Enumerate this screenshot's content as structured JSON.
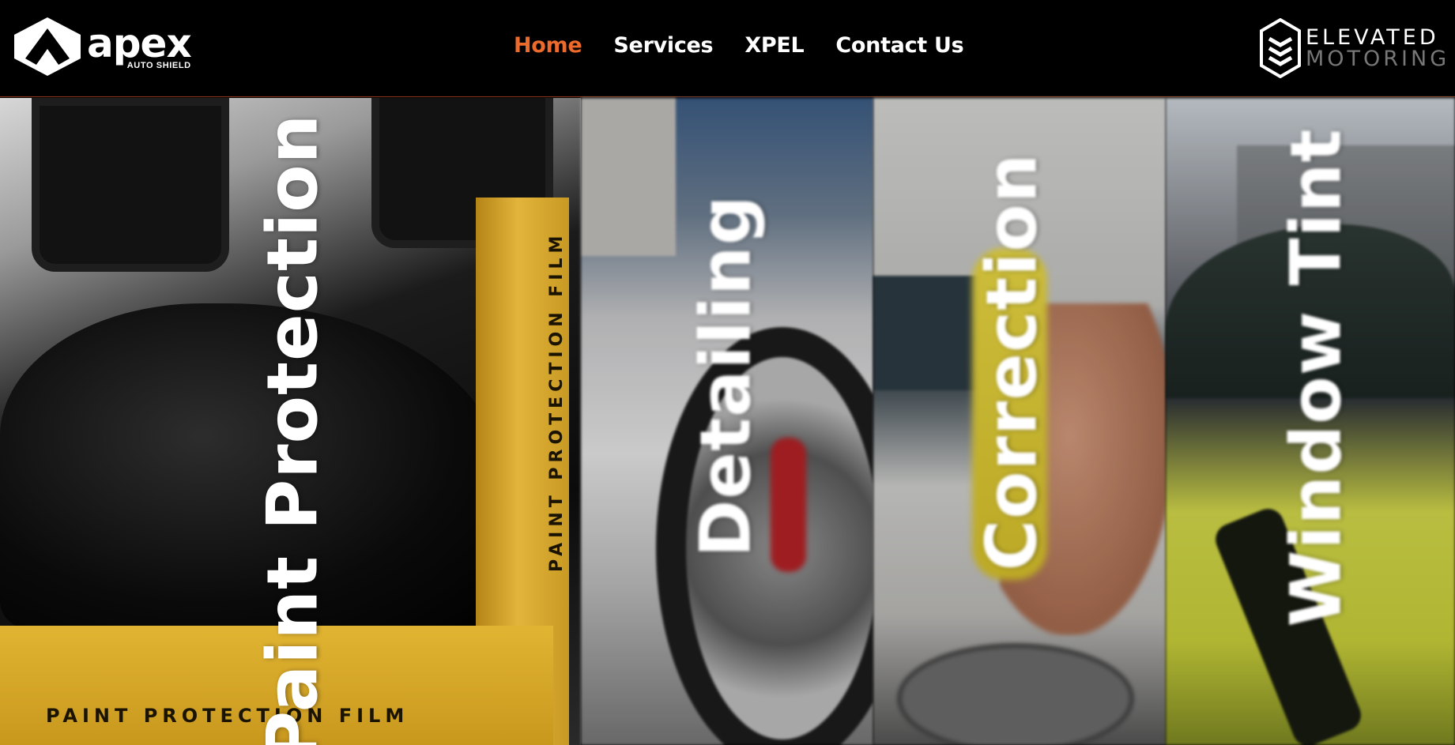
{
  "header": {
    "left_logo": {
      "name": "apex",
      "subtitle": "AUTO SHIELD",
      "icon": "apex-shield-icon"
    },
    "nav": [
      {
        "label": "Home",
        "active": true
      },
      {
        "label": "Services",
        "active": false
      },
      {
        "label": "XPEL",
        "active": false
      },
      {
        "label": "Contact Us",
        "active": false
      }
    ],
    "right_logo": {
      "line1": "ELEVATED",
      "line2": "MOTORING",
      "icon": "elevated-motoring-hexagon-icon"
    }
  },
  "panels": [
    {
      "label": "Paint Protection",
      "image": "black-supercar-with-paint-protection-film-box"
    },
    {
      "label": "Detailing",
      "image": "foamed-white-car-wheel"
    },
    {
      "label": "Correction",
      "image": "hand-polishing-white-car"
    },
    {
      "label": "Window Tint",
      "image": "yellow-car-near-building"
    }
  ],
  "photo_text": {
    "film_box": "PAINT PROTECTION FILM",
    "film_tube": "PAINT PROTECTION FILM"
  },
  "colors": {
    "background": "#000000",
    "nav_active": "#ec6a2c",
    "nav_text": "#ffffff",
    "header_border": "#8a3a1a"
  }
}
